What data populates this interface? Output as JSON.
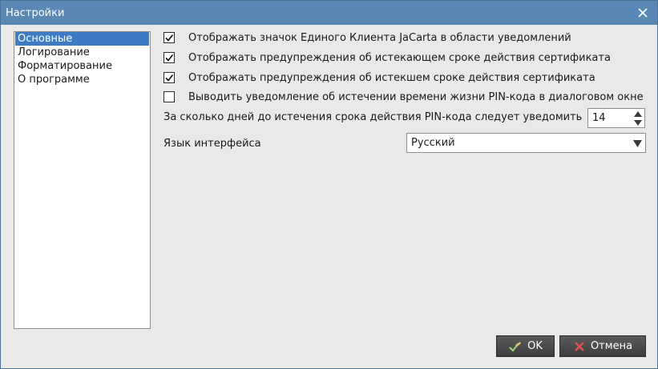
{
  "window": {
    "title": "Настройки"
  },
  "sidebar": {
    "items": [
      {
        "label": "Основные",
        "selected": true
      },
      {
        "label": "Логирование",
        "selected": false
      },
      {
        "label": "Форматирование",
        "selected": false
      },
      {
        "label": "О программе",
        "selected": false
      }
    ]
  },
  "settings": {
    "checkboxes": [
      {
        "label": "Отображать значок Единого Клиента JaCarta в области уведомлений",
        "checked": true
      },
      {
        "label": "Отображать предупреждения об истекающем сроке действия сертификата",
        "checked": true
      },
      {
        "label": "Отображать предупреждения об истекшем сроке действия сертификата",
        "checked": true
      },
      {
        "label": "Выводить уведомление об истечении времени жизни PIN-кода в диалоговом окне",
        "checked": false
      }
    ],
    "days_label": "За сколько дней до истечения срока действия PIN-кода следует уведомить",
    "days_value": "14",
    "language_label": "Язык интерфейса",
    "language_value": "Русский"
  },
  "buttons": {
    "ok": "OK",
    "cancel": "Отмена"
  }
}
